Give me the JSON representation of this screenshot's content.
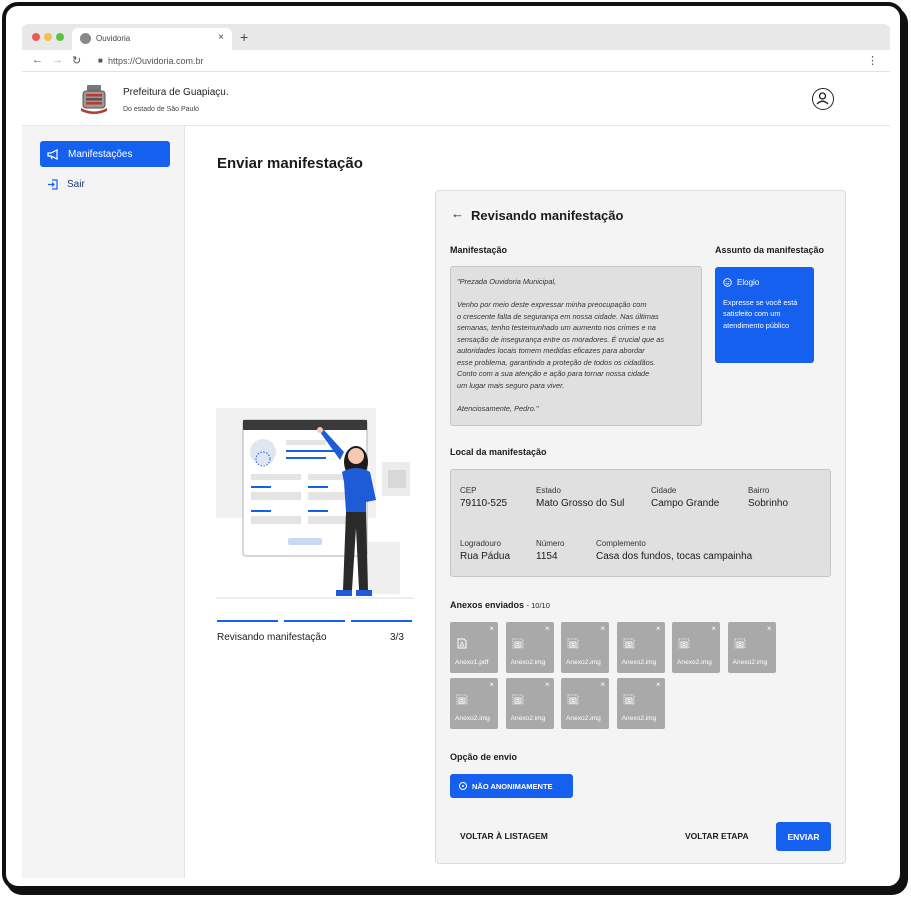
{
  "browser": {
    "tab_title": "Ouvidoria",
    "tab_close": "×",
    "new_tab": "+",
    "url": "https://Ouvidoria.com.br",
    "traffic_colors": [
      "#ee5a52",
      "#f5be4f",
      "#58c443"
    ]
  },
  "header": {
    "org_name": "Prefeitura de Guapiaçu.",
    "org_sub": "Do estado de São Paulo",
    "user_icon": "user-circle-icon"
  },
  "sidebar": {
    "items": [
      {
        "label": "Manifestações",
        "icon": "megaphone-icon",
        "active": true
      },
      {
        "label": "Sair",
        "icon": "logout-icon",
        "active": false
      }
    ]
  },
  "page": {
    "title": "Enviar manifestação"
  },
  "stepper": {
    "label": "Revisando manifestação",
    "count": "3/3",
    "progress": 1.0
  },
  "review": {
    "title": "Revisando manifestação",
    "manifest_label": "Manifestação",
    "subject_label": "Assunto da manifestação",
    "message": "\"Prezada Ouvidoria Municipal,\n\nVenho por meio deste expressar minha preocupação com\no crescente falta de segurança em nossa cidade. Nas últimas\nsemanas, tenho testemunhado um aumento nos crimes e na\nsensação de insegurança entre os moradores. É crucial que as\nautoridades locais tomem medidas eficazes para abordar\nesse problema, garantindo a proteção de todos os cidadãos.\nConto com a sua atenção e ação para tornar nossa cidade\num lugar mais seguro para viver.\n\nAtenciosamente, Pedro.\"",
    "subject": {
      "name": "Elogio",
      "icon": "smile-icon",
      "description": "Expresse se você está satisfeito com um atendimento público"
    },
    "location_label": "Local da manifestação",
    "location": {
      "cep_label": "CEP",
      "cep": "79110-525",
      "estado_label": "Estado",
      "estado": "Mato Grosso do Sul",
      "cidade_label": "Cidade",
      "cidade": "Campo Grande",
      "bairro_label": "Bairro",
      "bairro": "Sobrinho",
      "logradouro_label": "Logradouro",
      "logradouro": "Rua Pádua",
      "numero_label": "Número",
      "numero": "1154",
      "complemento_label": "Complemento",
      "complemento": "Casa dos fundos, tocas campainha"
    },
    "attachments_label": "Anexos enviados",
    "attachments_count": "- 10/10",
    "attachments": [
      {
        "name": "Anexo1.pdf",
        "icon": "pdf-file-icon"
      },
      {
        "name": "Anexo2.img",
        "icon": "image-file-icon"
      },
      {
        "name": "Anexo2.img",
        "icon": "image-file-icon"
      },
      {
        "name": "Anexo2.img",
        "icon": "image-file-icon"
      },
      {
        "name": "Anexo2.img",
        "icon": "image-file-icon"
      },
      {
        "name": "Anexo2.img",
        "icon": "image-file-icon"
      },
      {
        "name": "Anexo2.img",
        "icon": "image-file-icon"
      },
      {
        "name": "Anexo2.img",
        "icon": "image-file-icon"
      },
      {
        "name": "Anexo2.img",
        "icon": "image-file-icon"
      },
      {
        "name": "Anexo2.img",
        "icon": "image-file-icon"
      }
    ],
    "remove_glyph": "×",
    "send_option_label": "Opção de envio",
    "send_option_value": "NÃO ANONIMAMENTE",
    "buttons": {
      "back_list": "VOLTAR À LISTAGEM",
      "back_step": "VOLTAR ETAPA",
      "send": "ENVIAR"
    }
  },
  "colors": {
    "primary": "#1660f0",
    "panel": "#f4f4f4",
    "field": "#e0e0e0",
    "attachment": "#a9a9a9"
  }
}
